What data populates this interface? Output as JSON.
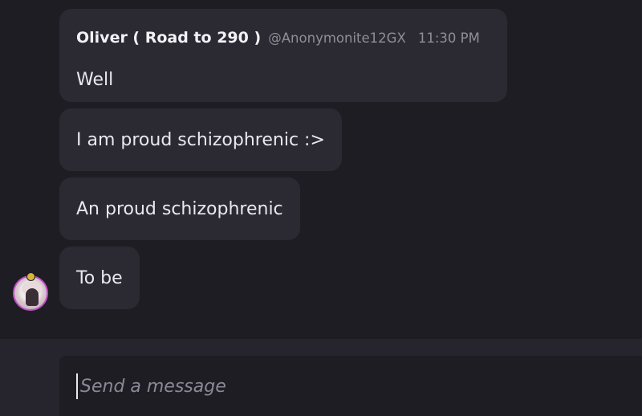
{
  "messages": [
    {
      "author": "Oliver ( Road to 290 )",
      "handle": "@Anonymonite12GX",
      "time": "11:30 PM",
      "text": "Well"
    },
    {
      "text": "I am proud schizophrenic :>"
    },
    {
      "text": "An proud schizophrenic"
    },
    {
      "text": "To be"
    }
  ],
  "composer": {
    "placeholder": "Send a message",
    "value": ""
  },
  "colors": {
    "background": "#1e1d24",
    "bubble": "#2b2a33",
    "muted_text": "#8f8d99",
    "avatar_ring": "#c452c9"
  },
  "icons": {
    "avatar": "user-avatar",
    "badge": "status-badge"
  }
}
